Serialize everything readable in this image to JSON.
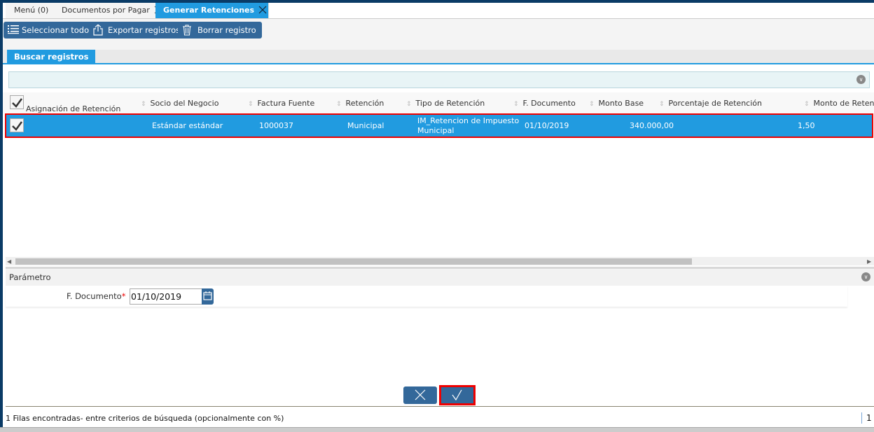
{
  "tabs": [
    {
      "label": "Menú (0)",
      "active": false,
      "closable": false
    },
    {
      "label": "Documentos por Pagar",
      "active": false,
      "closable": true
    },
    {
      "label": "Generar Retenciones",
      "active": true,
      "closable": true
    }
  ],
  "toolbar": {
    "select_all": "Seleccionar todo",
    "export": "Exportar registros",
    "delete": "Borrar registro"
  },
  "search_tab": "Buscar registros",
  "grid": {
    "columns": [
      "Asignación de Retención",
      "Socio del Negocio",
      "Factura Fuente",
      "Retención",
      "Tipo de Retención",
      "F. Documento",
      "Monto Base",
      "Porcentaje de Retención",
      "Monto de Reten"
    ],
    "rows": [
      {
        "checked": true,
        "socio": "Estándar estándar",
        "factura": "1000037",
        "retencion": "Municipal",
        "tipo_l1": "IM_Retencion de Impuesto",
        "tipo_l2": "Municipal",
        "fecha": "01/10/2019",
        "monto_base": "340.000,00",
        "porcentaje": "1,50"
      }
    ],
    "horizontal_scroll_position_percent": 0
  },
  "parameters": {
    "title": "Parámetro",
    "f_documento_label": "F. Documento",
    "required_mark": "*",
    "f_documento_value": "01/10/2019"
  },
  "status": {
    "message": "1 Filas encontradas- entre criterios de búsqueda (opcionalmente con %)",
    "page": "1"
  },
  "colors": {
    "accent": "#219be0",
    "button": "#33689a",
    "highlight_annotation": "#ee0000"
  }
}
